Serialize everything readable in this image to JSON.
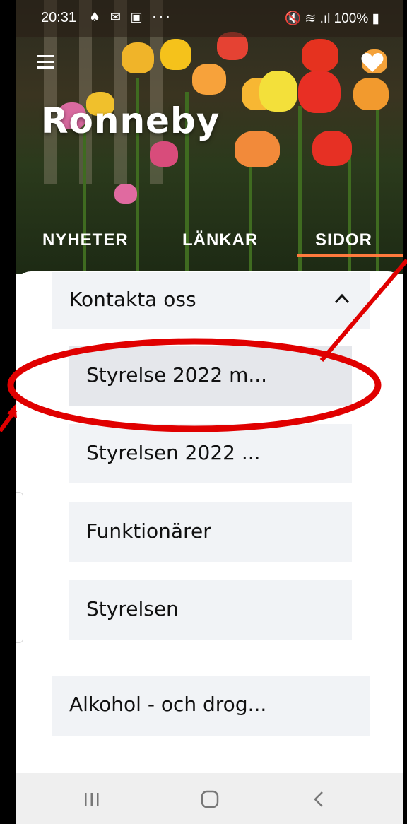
{
  "status_bar": {
    "time": "20:31",
    "left_icons": "♠ ✉ ▣ ···",
    "right_text": "🔇 ≋ .ıl 100% ▮"
  },
  "header": {
    "title": "Ronneby",
    "menu_icon": "hamburger-icon",
    "favorite_icon": "heart-icon"
  },
  "tabs": [
    {
      "label": "NYHETER"
    },
    {
      "label": "LÄNKAR"
    },
    {
      "label": "SIDOR"
    }
  ],
  "content": {
    "section": {
      "label": "Kontakta oss",
      "expanded": true
    },
    "items": [
      {
        "label": "Styrelse 2022 m..."
      },
      {
        "label": "Styrelsen 2022 ..."
      },
      {
        "label": "Funktionärer"
      },
      {
        "label": "Styrelsen"
      }
    ],
    "next_section": {
      "label": "Alkohol - och drog..."
    }
  },
  "colors": {
    "accent": "#ff7a3d",
    "annotation": "#e00000",
    "item_bg": "#f1f3f6"
  },
  "nav": {
    "recent_icon": "recent-apps-icon",
    "home_icon": "home-icon",
    "back_icon": "back-icon"
  }
}
